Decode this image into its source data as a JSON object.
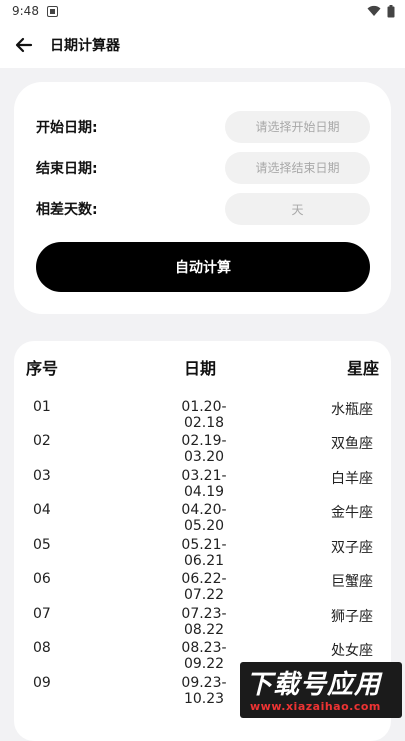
{
  "status": {
    "time": "9:48"
  },
  "appbar": {
    "title": "日期计算器"
  },
  "form": {
    "start_label": "开始日期:",
    "start_placeholder": "请选择开始日期",
    "end_label": "结束日期:",
    "end_placeholder": "请选择结束日期",
    "diff_label": "相差天数:",
    "diff_unit": "天",
    "calc_button": "自动计算"
  },
  "table": {
    "headers": [
      "序号",
      "日期",
      "星座"
    ],
    "rows": [
      {
        "no": "01",
        "date": "01.20-02.18",
        "sign": "水瓶座"
      },
      {
        "no": "02",
        "date": "02.19-03.20",
        "sign": "双鱼座"
      },
      {
        "no": "03",
        "date": "03.21-04.19",
        "sign": "白羊座"
      },
      {
        "no": "04",
        "date": "04.20-05.20",
        "sign": "金牛座"
      },
      {
        "no": "05",
        "date": "05.21-06.21",
        "sign": "双子座"
      },
      {
        "no": "06",
        "date": "06.22-07.22",
        "sign": "巨蟹座"
      },
      {
        "no": "07",
        "date": "07.23-08.22",
        "sign": "狮子座"
      },
      {
        "no": "08",
        "date": "08.23-09.22",
        "sign": "处女座"
      },
      {
        "no": "09",
        "date": "09.23-10.23",
        "sign": ""
      }
    ]
  },
  "watermark": {
    "line1": "下载号应用",
    "line2": "www.xiazaihao.com"
  }
}
